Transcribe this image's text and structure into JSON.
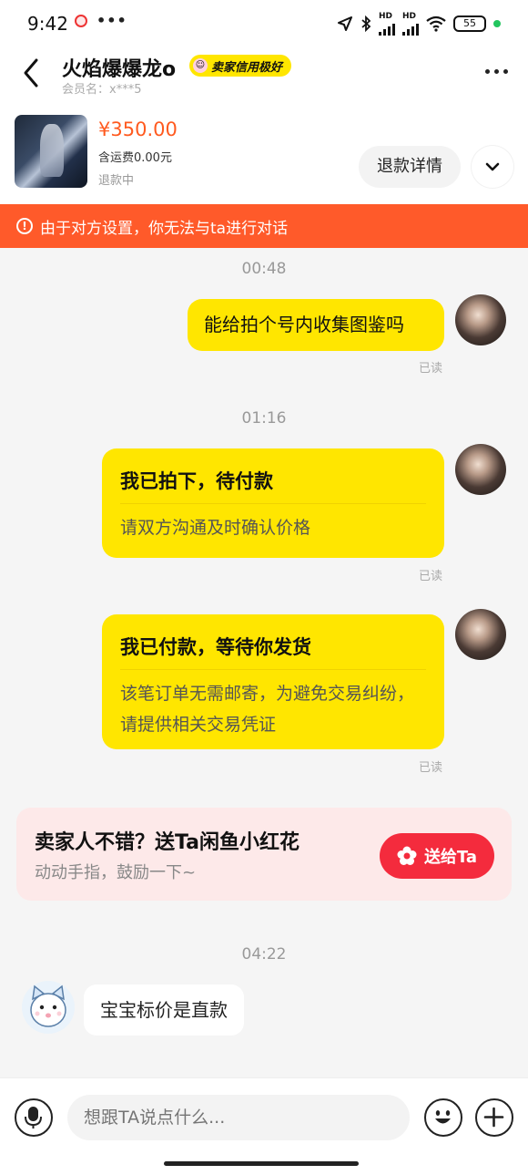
{
  "status_bar": {
    "time": "9:42",
    "battery": "55",
    "hd1": "HD",
    "hd2": "HD"
  },
  "header": {
    "seller_name": "火焰爆爆龙o",
    "credit_badge": "卖家信用极好",
    "member": "会员名：x***5"
  },
  "product": {
    "price": "¥350.00",
    "shipping": "含运费0.00元",
    "status": "退款中",
    "refund_button": "退款详情"
  },
  "notice": {
    "icon": "!",
    "text": "由于对方设置，你无法与ta进行对话"
  },
  "chat": {
    "ts1": "00:48",
    "msg1": "能给拍个号内收集图鉴吗",
    "read1": "已读",
    "ts2": "01:16",
    "card1_title": "我已拍下，待付款",
    "card1_desc": "请双方沟通及时确认价格",
    "read2": "已读",
    "card2_title": "我已付款，等待你发货",
    "card2_desc": "该笔订单无需邮寄，为避免交易纠纷，请提供相关交易凭证",
    "read3": "已读",
    "ts3": "04:22",
    "seller_msg": "宝宝标价是直款"
  },
  "promo": {
    "title": "卖家人不错？送Ta闲鱼小红花",
    "subtitle": "动动手指，鼓励一下~",
    "button": "送给Ta"
  },
  "input": {
    "placeholder": "想跟TA说点什么..."
  },
  "colors": {
    "accent_yellow": "#ffe600",
    "notice_orange": "#ff5a2a",
    "price": "#ff5a1f",
    "promo_red": "#f42b3d"
  }
}
